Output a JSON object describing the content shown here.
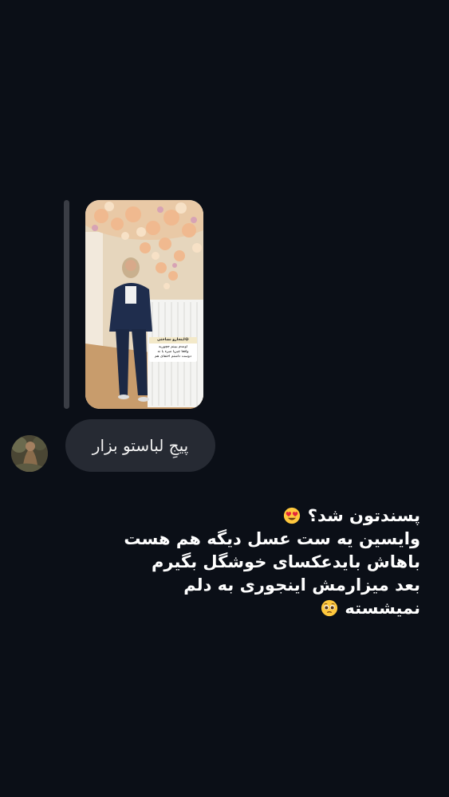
{
  "shared_story": {
    "caption_lines": [
      "اینجارو نشاختی😂",
      "اومدم ببینم جچوریه",
      "واقعا چیزیا میره یا نه",
      "دوست داشتم اختفای هم"
    ]
  },
  "reply_bubble": {
    "text": "پیجِ لباستو بزار"
  },
  "message": {
    "lines": [
      "پسندتون شد؟",
      "وایسین یه ست عسل دیگه هم هست",
      "باهاش بایدعکسای خوشگل بگیرم",
      "بعد میزارمش اینجوری به دلم",
      "نمیشسته"
    ],
    "emoji_1": "heart-eyes-emoji",
    "emoji_2": "pleading-face-emoji"
  },
  "colors": {
    "background": "#0b0f17",
    "bubble": "#262a33",
    "reply_bar": "#3a3d45",
    "text": "#ffffff"
  }
}
